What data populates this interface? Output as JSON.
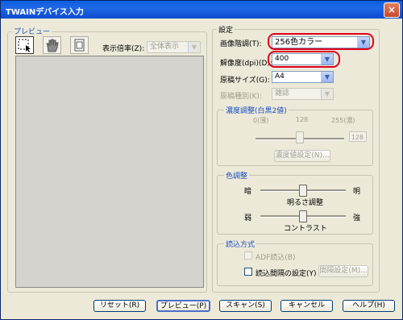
{
  "window": {
    "title": "TWAINデバイス入力",
    "close": "×"
  },
  "preview": {
    "group_label": "プレビュー",
    "zoom_label": "表示倍率(Z):",
    "zoom_value": "全体表示"
  },
  "settings": {
    "group_label": "設定",
    "gradation_label": "画像階調(T):",
    "gradation_value": "256色カラー",
    "resolution_label": "解像度(dpi)(D):",
    "resolution_value": "400",
    "size_label": "原稿サイズ(G):",
    "size_value": "A4",
    "type_label": "原稿種別(K):",
    "type_value": "雑誌"
  },
  "density": {
    "group_label": "濃度調整(白黒2値)",
    "tick_min": "0(薄)",
    "tick_mid": "128",
    "tick_max": "255(濃)",
    "value": "128",
    "button": "濃度値設定(N)..."
  },
  "color_adjust": {
    "group_label": "色調整",
    "bright_left": "暗",
    "bright_right": "明",
    "bright_caption": "明るさ調整",
    "bright_level": 0.5,
    "contrast_left": "弱",
    "contrast_right": "強",
    "contrast_caption": "コントラスト",
    "contrast_level": 0.5
  },
  "read_mode": {
    "group_label": "読込方式",
    "adf_label": "ADF読込(B)",
    "interval_label": "読込間隔の設定(Y)",
    "interval_button": "間隔設定(M)..."
  },
  "buttons": {
    "reset": "リセット(R)",
    "preview": "プレビュー(P)",
    "scan": "スキャン(S)",
    "cancel": "キャンセル",
    "help": "ヘルプ(H)"
  },
  "colors": {
    "titlebar": "#0a5ee0",
    "group_label": "#1a4fc0",
    "highlight": "#e0001e"
  }
}
